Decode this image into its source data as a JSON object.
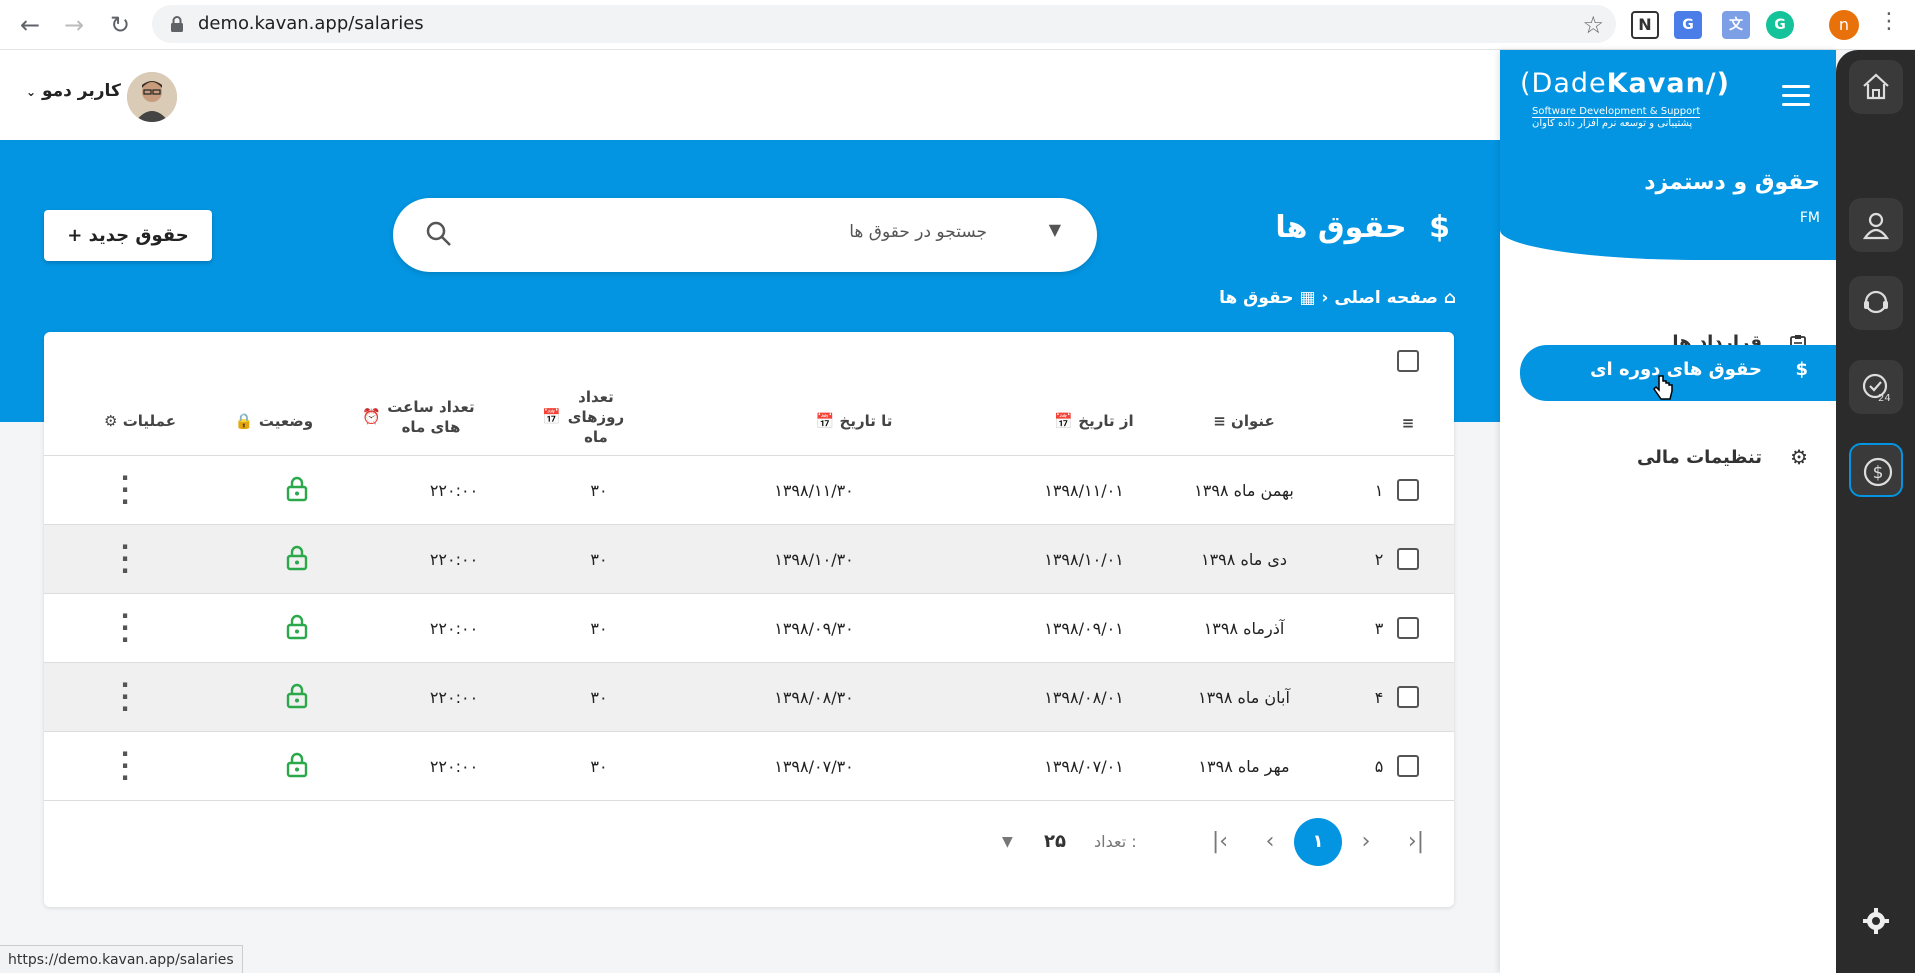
{
  "browser": {
    "url": "demo.kavan.app/salaries",
    "status_url": "https://demo.kavan.app/salaries",
    "profile_initial": "n"
  },
  "header": {
    "user_name": "کاربر دمو"
  },
  "page": {
    "title": "حقوق ها",
    "title_icon": "$",
    "breadcrumb": [
      "صفحه اصلی",
      "حقوق ها"
    ],
    "search_placeholder": "جستجو در حقوق ها",
    "new_button_label": "+ حقوق جدید"
  },
  "table": {
    "columns": {
      "title": "عنوان",
      "from": "از تاریخ",
      "to": "تا تاریخ",
      "days": "تعداد روزهای ماه",
      "hours": "تعداد ساعت های ماه",
      "status": "وضعیت",
      "actions": "عملیات"
    },
    "rows": [
      {
        "num": "۱",
        "title": "بهمن ماه ۱۳۹۸",
        "from": "۱۳۹۸/۱۱/۰۱",
        "to": "۱۳۹۸/۱۱/۳۰",
        "days": "۳۰",
        "hours": "۲۲۰:۰۰"
      },
      {
        "num": "۲",
        "title": "دی ماه ۱۳۹۸",
        "from": "۱۳۹۸/۱۰/۰۱",
        "to": "۱۳۹۸/۱۰/۳۰",
        "days": "۳۰",
        "hours": "۲۲۰:۰۰"
      },
      {
        "num": "۳",
        "title": "آذرماه ۱۳۹۸",
        "from": "۱۳۹۸/۰۹/۰۱",
        "to": "۱۳۹۸/۰۹/۳۰",
        "days": "۳۰",
        "hours": "۲۲۰:۰۰"
      },
      {
        "num": "۴",
        "title": "آبان ماه ۱۳۹۸",
        "from": "۱۳۹۸/۰۸/۰۱",
        "to": "۱۳۹۸/۰۸/۳۰",
        "days": "۳۰",
        "hours": "۲۲۰:۰۰"
      },
      {
        "num": "۵",
        "title": "مهر ماه ۱۳۹۸",
        "from": "۱۳۹۸/۰۷/۰۱",
        "to": "۱۳۹۸/۰۷/۳۰",
        "days": "۳۰",
        "hours": "۲۲۰:۰۰"
      }
    ],
    "pager": {
      "current_page": "۱",
      "count_label": "تعداد :",
      "page_size": "۲۵"
    }
  },
  "sidenav": {
    "logo_brand_left": "(Dade",
    "logo_brand_right": "Kavan/)",
    "logo_sub1": "Software Development & Support",
    "logo_sub2": "پشتیبانی و توسعه نرم افزار داده کاوان",
    "module_title": "حقوق و دستمزد",
    "module_code": "FM",
    "items": [
      {
        "label": "قرارداد ها",
        "icon": "clipboard-icon"
      },
      {
        "label": "حقوق های دوره ای",
        "icon": "dollar-icon"
      },
      {
        "label": "تنظیمات مالی",
        "icon": "gear-icon"
      }
    ]
  },
  "colors": {
    "primary": "#0395e2",
    "rail": "#2b2b2b",
    "status_green": "#2aa84a"
  }
}
